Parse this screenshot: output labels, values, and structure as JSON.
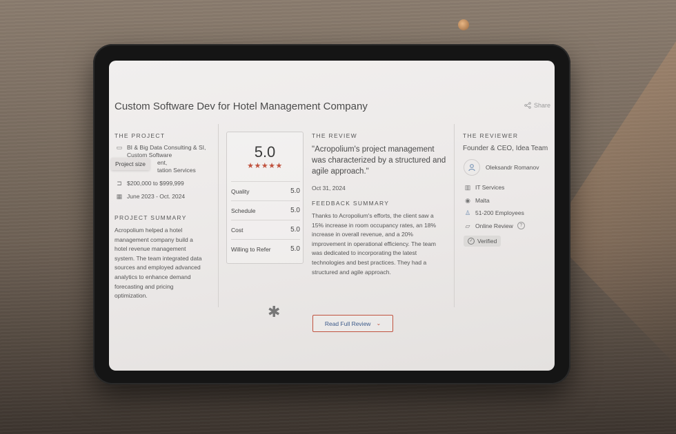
{
  "header": {
    "title": "Custom Software Dev for Hotel Management Company",
    "share_label": "Share"
  },
  "project": {
    "heading": "THE PROJECT",
    "services_line1": "BI & Big Data Consulting & SI,",
    "services_line2": "Custom Software",
    "services_line3": "ent,",
    "services_line4": "tation Services",
    "budget": "$200,000 to $999,999",
    "dates": "June 2023 - Oct. 2024",
    "tooltip": "Project size",
    "summary_heading": "PROJECT SUMMARY",
    "summary_lines": [
      "Acropolium helped a hotel",
      "management company build a",
      "hotel revenue management",
      "system. The team integrated data",
      "sources and employed advanced",
      "analytics to enhance demand",
      "forecasting and pricing",
      "optimization."
    ]
  },
  "rating": {
    "score": "5.0",
    "stars": "★★★★★",
    "rows": [
      {
        "label": "Quality",
        "value": "5.0"
      },
      {
        "label": "Schedule",
        "value": "5.0"
      },
      {
        "label": "Cost",
        "value": "5.0"
      },
      {
        "label": "Willing to Refer",
        "value": "5.0"
      }
    ]
  },
  "review": {
    "heading": "THE REVIEW",
    "quote_lines": [
      "\"Acropolium's project management",
      "was characterized by a structured and",
      "agile approach.\""
    ],
    "date": "Oct 31, 2024",
    "feedback_heading": "FEEDBACK SUMMARY",
    "feedback_lines": [
      "Thanks to Acropolium's efforts, the client saw a",
      "15% increase in room occupancy rates, an 18%",
      "increase in overall revenue, and a 20%",
      "improvement in operational efficiency. The team",
      "was dedicated to incorporating the latest",
      "technologies and best practices. They had a",
      "structured and agile approach."
    ],
    "read_more_label": "Read Full Review"
  },
  "reviewer": {
    "heading": "THE REVIEWER",
    "role": "Founder & CEO, Idea Team",
    "name": "Oleksandr Romanov",
    "industry": "IT Services",
    "location": "Malta",
    "size": "51-200 Employees",
    "review_type": "Online Review",
    "verified": "Verified"
  },
  "colors": {
    "accent": "#c0523e",
    "link": "#3c5a8a"
  }
}
